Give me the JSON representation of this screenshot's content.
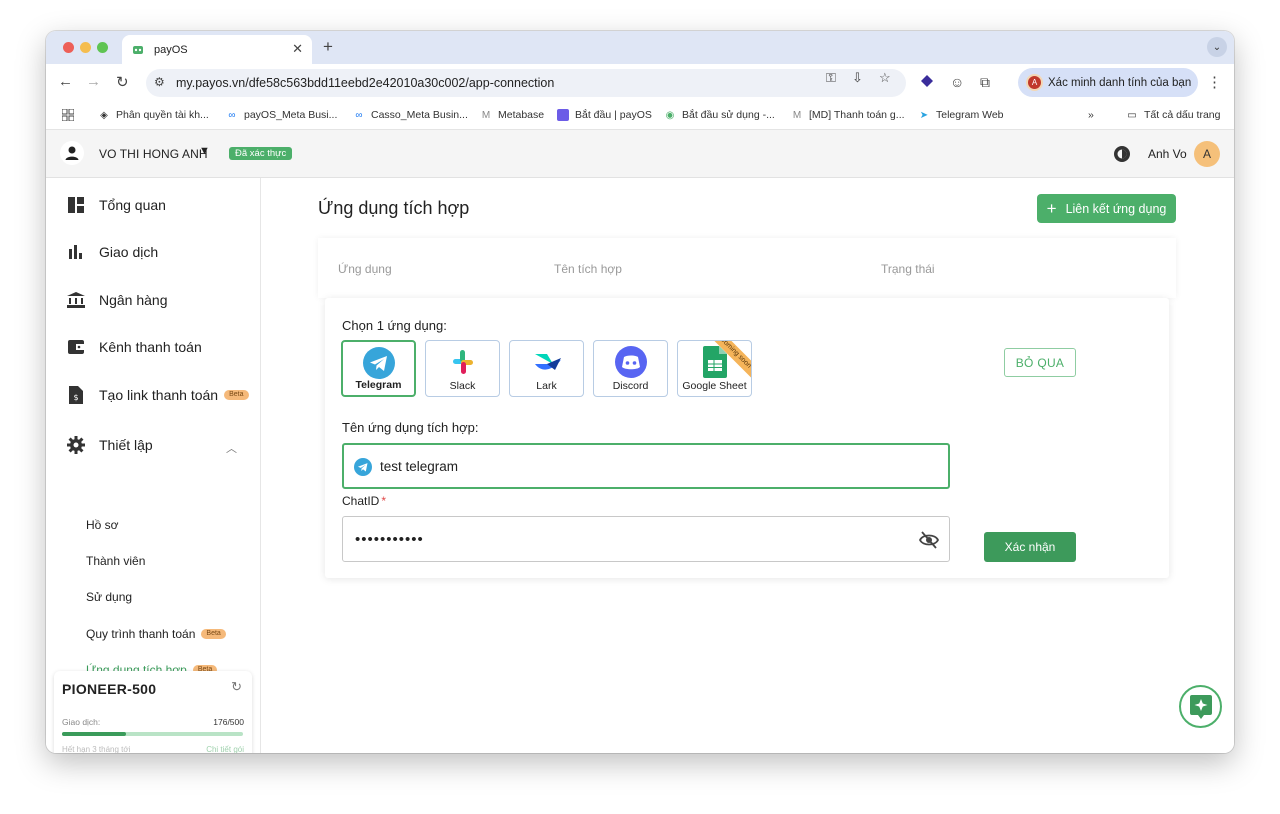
{
  "browser": {
    "tab_title": "payOS",
    "url": "my.payos.vn/dfe58c563bdd11eebd2e42010a30c002/app-connection",
    "profile_label": "Xác minh danh tính của bạn",
    "profile_initial": "A",
    "bookmarks": [
      "Phân quyền tài kh...",
      "payOS_Meta Busi...",
      "Casso_Meta Busin...",
      "Metabase",
      "Bắt đầu | payOS",
      "Bắt đầu sử dụng -...",
      "[MD] Thanh toán g...",
      "Telegram Web"
    ],
    "bookmarks_all": "Tất cả dấu trang"
  },
  "header": {
    "org_name": "VO THI HONG ANH",
    "verified_badge": "Đã xác thực",
    "user_name": "Anh Vo",
    "user_initial": "A"
  },
  "sidebar": {
    "items": [
      {
        "label": "Tổng quan"
      },
      {
        "label": "Giao dịch"
      },
      {
        "label": "Ngân hàng"
      },
      {
        "label": "Kênh thanh toán"
      },
      {
        "label": "Tạo link thanh toán",
        "badge": "Beta"
      },
      {
        "label": "Thiết lập"
      }
    ],
    "sub_items": [
      {
        "label": "Hồ sơ"
      },
      {
        "label": "Thành viên"
      },
      {
        "label": "Sử dụng"
      },
      {
        "label": "Quy trình thanh toán",
        "badge": "Beta"
      },
      {
        "label": "Ứng dụng tích hợp",
        "badge": "Beta"
      }
    ],
    "plan": {
      "name": "PIONEER-500",
      "usage_label": "Giao dịch:",
      "usage_count": "176/500",
      "usage_fraction": 0.352,
      "next_label": "Hết hạn 3 tháng tới",
      "detail_link": "Chi tiết gói"
    }
  },
  "main": {
    "title": "Ứng dụng tích hợp",
    "add_button": "Liên kết ứng dụng",
    "columns": [
      "Ứng dụng",
      "Tên tích hợp",
      "Trạng thái"
    ],
    "choose_label": "Chọn 1 ứng dụng:",
    "apps": [
      {
        "name": "Telegram",
        "selected": true
      },
      {
        "name": "Slack"
      },
      {
        "name": "Lark"
      },
      {
        "name": "Discord"
      },
      {
        "name": "Google Sheet",
        "ribbon": "Coming soon"
      }
    ],
    "skip_button": "BỎ QUA",
    "name_label": "Tên ứng dụng tích hợp:",
    "name_value": "test telegram",
    "chat_label": "ChatID",
    "chat_required": "*",
    "chat_value": "•••••••••••",
    "confirm_button": "Xác nhận"
  },
  "colors": {
    "primary": "#4caf6a",
    "primary_dark": "#3d9a5b",
    "beta_badge": "#f5b97a",
    "tab_strip": "#dfe6f5"
  }
}
